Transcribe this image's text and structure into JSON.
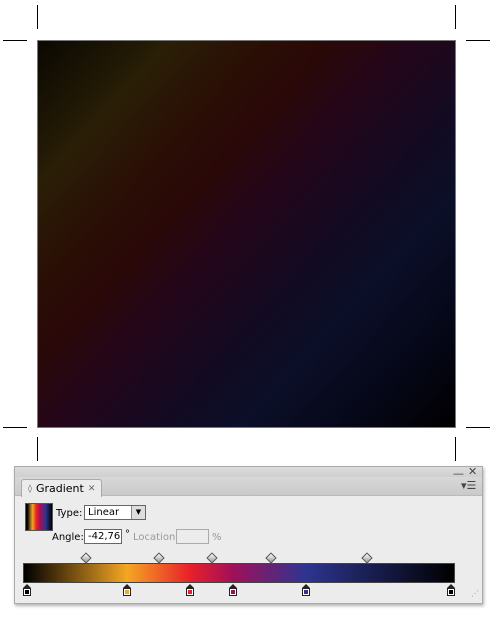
{
  "panel": {
    "tab_label": "Gradient",
    "type_label": "Type:",
    "type_value": "Linear",
    "angle_label": "Angle:",
    "angle_value": "-42,76",
    "degree_symbol": "°",
    "location_label": "Location:",
    "location_value": "",
    "percent_symbol": "%"
  },
  "gradient": {
    "stops": [
      {
        "position": 0,
        "color": "#000000"
      },
      {
        "position": 24,
        "color": "#f5a623"
      },
      {
        "position": 38.6,
        "color": "#e8202a"
      },
      {
        "position": 48.6,
        "color": "#a0105a"
      },
      {
        "position": 65.5,
        "color": "#2d3590"
      },
      {
        "position": 100,
        "color": "#000000"
      }
    ],
    "midpoints": [
      14.6,
      31.5,
      43.8,
      57.4,
      79.6
    ]
  }
}
